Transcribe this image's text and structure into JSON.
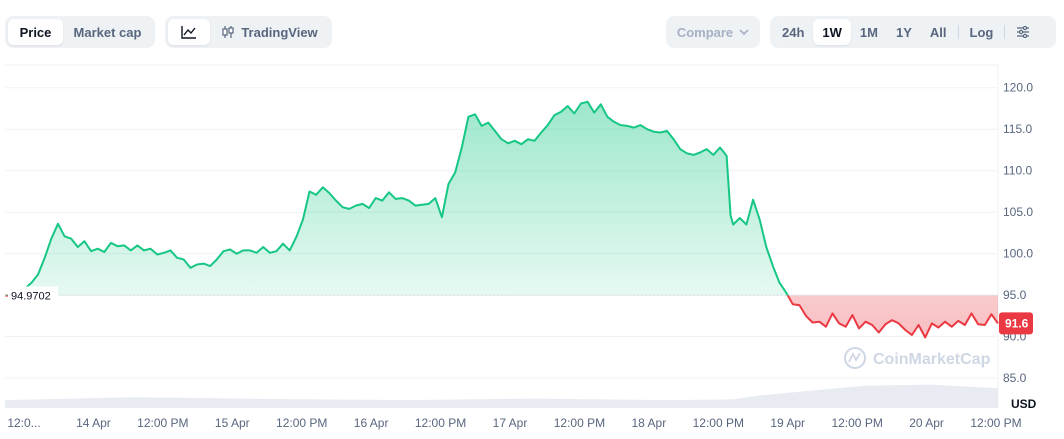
{
  "toolbar": {
    "type_tabs": [
      {
        "label": "Price",
        "active": true
      },
      {
        "label": "Market cap",
        "active": false
      }
    ],
    "view_tabs": [
      {
        "icon": "line-chart-icon",
        "label": "",
        "active": true
      },
      {
        "icon": "candlestick-icon",
        "label": "TradingView",
        "active": false
      }
    ],
    "compare_label": "Compare",
    "range_tabs": [
      {
        "label": "24h",
        "active": false
      },
      {
        "label": "1W",
        "active": true
      },
      {
        "label": "1M",
        "active": false
      },
      {
        "label": "1Y",
        "active": false
      },
      {
        "label": "All",
        "active": false
      }
    ],
    "log_label": "Log",
    "settings_icon": "sliders-icon"
  },
  "chart_data": {
    "type": "area",
    "y_ticks": [
      85.0,
      90.0,
      95.0,
      100.0,
      105.0,
      110.0,
      115.0,
      120.0
    ],
    "y_tick_labels": [
      "85.0",
      "90.0",
      "95.0",
      "100.0",
      "105.0",
      "110.0",
      "115.0",
      "120.0"
    ],
    "ylim": [
      81.4,
      122.5
    ],
    "x_ticks": [
      "12:0...",
      "14 Apr",
      "12:00 PM",
      "15 Apr",
      "12:00 PM",
      "16 Apr",
      "12:00 PM",
      "17 Apr",
      "12:00 PM",
      "18 Apr",
      "12:00 PM",
      "19 Apr",
      "12:00 PM",
      "20 Apr",
      "12:00 PM"
    ],
    "baseline_value": 94.9702,
    "baseline_label": "94.9702",
    "current_value": 91.6,
    "current_label": "91.6",
    "currency_label": "USD",
    "watermark": "CoinMarketCap",
    "colors": {
      "up": "#16c784",
      "down": "#ea3943",
      "grid": "#eff2f5",
      "volume": "#e8ecf2",
      "text": "#58667e"
    },
    "price": [
      [
        0,
        94.97
      ],
      [
        0.5,
        94.9
      ],
      [
        1,
        95.2
      ],
      [
        1.5,
        95.8
      ],
      [
        2,
        96.5
      ],
      [
        2.5,
        97.5
      ],
      [
        3,
        99.5
      ],
      [
        3.5,
        101.8
      ],
      [
        4,
        103.6
      ],
      [
        4.5,
        102.1
      ],
      [
        5,
        101.8
      ],
      [
        5.5,
        100.8
      ],
      [
        6,
        101.5
      ],
      [
        6.5,
        100.3
      ],
      [
        7,
        100.6
      ],
      [
        7.5,
        100.2
      ],
      [
        8,
        101.3
      ],
      [
        8.5,
        100.9
      ],
      [
        9,
        101.0
      ],
      [
        9.5,
        100.4
      ],
      [
        10,
        101.0
      ],
      [
        10.5,
        100.4
      ],
      [
        11,
        100.6
      ],
      [
        11.5,
        99.9
      ],
      [
        12,
        100.1
      ],
      [
        12.5,
        100.4
      ],
      [
        13,
        99.5
      ],
      [
        13.5,
        99.3
      ],
      [
        14,
        98.3
      ],
      [
        14.5,
        98.7
      ],
      [
        15,
        98.8
      ],
      [
        15.5,
        98.5
      ],
      [
        16,
        99.3
      ],
      [
        16.5,
        100.3
      ],
      [
        17,
        100.5
      ],
      [
        17.5,
        100.0
      ],
      [
        18,
        100.4
      ],
      [
        18.5,
        100.4
      ],
      [
        19,
        100.1
      ],
      [
        19.5,
        100.8
      ],
      [
        20,
        100.1
      ],
      [
        20.5,
        100.3
      ],
      [
        21,
        101.2
      ],
      [
        21.5,
        100.4
      ],
      [
        22,
        102.0
      ],
      [
        22.5,
        104.1
      ],
      [
        23,
        107.5
      ],
      [
        23.5,
        107.1
      ],
      [
        24,
        108.0
      ],
      [
        24.5,
        107.3
      ],
      [
        25,
        106.4
      ],
      [
        25.5,
        105.6
      ],
      [
        26,
        105.4
      ],
      [
        26.5,
        105.8
      ],
      [
        27,
        106.0
      ],
      [
        27.5,
        105.5
      ],
      [
        28,
        106.7
      ],
      [
        28.5,
        106.4
      ],
      [
        29,
        107.4
      ],
      [
        29.5,
        106.6
      ],
      [
        30,
        106.7
      ],
      [
        30.5,
        106.4
      ],
      [
        31,
        105.8
      ],
      [
        31.5,
        105.9
      ],
      [
        32,
        106.0
      ],
      [
        32.5,
        106.7
      ],
      [
        33,
        104.4
      ],
      [
        33.5,
        108.4
      ],
      [
        34,
        109.8
      ],
      [
        34.5,
        112.8
      ],
      [
        35,
        116.5
      ],
      [
        35.5,
        116.8
      ],
      [
        36,
        115.4
      ],
      [
        36.5,
        115.8
      ],
      [
        37,
        114.8
      ],
      [
        37.5,
        113.8
      ],
      [
        38,
        113.3
      ],
      [
        38.5,
        113.6
      ],
      [
        39,
        113.2
      ],
      [
        39.5,
        113.8
      ],
      [
        40,
        113.6
      ],
      [
        40.5,
        114.6
      ],
      [
        41,
        115.5
      ],
      [
        41.5,
        116.7
      ],
      [
        42,
        117.1
      ],
      [
        42.5,
        117.8
      ],
      [
        43,
        116.9
      ],
      [
        43.5,
        118.1
      ],
      [
        44,
        118.3
      ],
      [
        44.5,
        117.0
      ],
      [
        45,
        118.0
      ],
      [
        45.5,
        116.5
      ],
      [
        46,
        115.9
      ],
      [
        46.5,
        115.5
      ],
      [
        47,
        115.4
      ],
      [
        47.5,
        115.2
      ],
      [
        48,
        115.5
      ],
      [
        48.5,
        115.0
      ],
      [
        49,
        114.7
      ],
      [
        49.5,
        114.6
      ],
      [
        50,
        114.8
      ],
      [
        50.5,
        113.8
      ],
      [
        51,
        112.6
      ],
      [
        51.5,
        112.1
      ],
      [
        52,
        111.9
      ],
      [
        52.5,
        112.2
      ],
      [
        53,
        112.6
      ],
      [
        53.5,
        111.9
      ],
      [
        54,
        112.8
      ],
      [
        54.5,
        111.8
      ],
      [
        54.8,
        104.6
      ],
      [
        55,
        103.5
      ],
      [
        55.5,
        104.3
      ],
      [
        56,
        103.5
      ],
      [
        56.5,
        106.5
      ],
      [
        57,
        104.1
      ],
      [
        57.5,
        100.8
      ],
      [
        58,
        98.5
      ],
      [
        58.5,
        96.5
      ],
      [
        59,
        95.3
      ],
      [
        59.5,
        93.9
      ],
      [
        60,
        93.8
      ],
      [
        60.5,
        92.5
      ],
      [
        61,
        91.7
      ],
      [
        61.5,
        91.8
      ],
      [
        62,
        91.2
      ],
      [
        62.5,
        92.8
      ],
      [
        63,
        91.6
      ],
      [
        63.5,
        91.2
      ],
      [
        64,
        92.6
      ],
      [
        64.5,
        91.0
      ],
      [
        65,
        91.8
      ],
      [
        65.5,
        91.4
      ],
      [
        66,
        90.5
      ],
      [
        66.5,
        91.5
      ],
      [
        67,
        92.0
      ],
      [
        67.5,
        91.6
      ],
      [
        68,
        90.8
      ],
      [
        68.5,
        90.2
      ],
      [
        69,
        91.4
      ],
      [
        69.5,
        89.9
      ],
      [
        70,
        91.6
      ],
      [
        70.5,
        91.1
      ],
      [
        71,
        91.8
      ],
      [
        71.5,
        91.2
      ],
      [
        72,
        91.9
      ],
      [
        72.5,
        91.4
      ],
      [
        73,
        92.8
      ],
      [
        73.5,
        91.5
      ],
      [
        74,
        91.4
      ],
      [
        74.5,
        92.7
      ],
      [
        75,
        91.6
      ]
    ],
    "volume": [
      [
        0,
        0.22
      ],
      [
        10,
        0.3
      ],
      [
        20,
        0.25
      ],
      [
        30,
        0.22
      ],
      [
        40,
        0.26
      ],
      [
        50,
        0.22
      ],
      [
        55,
        0.24
      ],
      [
        57,
        0.35
      ],
      [
        60,
        0.45
      ],
      [
        65,
        0.62
      ],
      [
        70,
        0.65
      ],
      [
        75,
        0.55
      ]
    ],
    "x_range": [
      0,
      75
    ]
  }
}
